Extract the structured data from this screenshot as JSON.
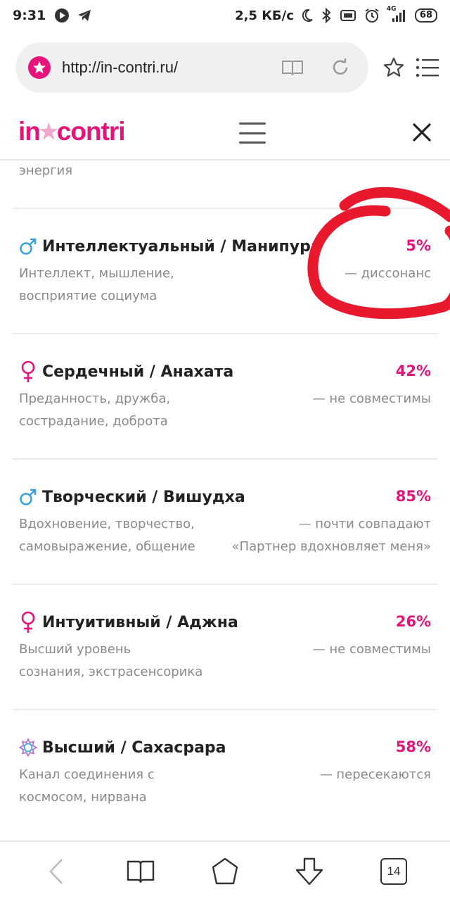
{
  "status_bar": {
    "time": "9:31",
    "net_speed": "2,5 КБ/с",
    "network": "4G",
    "battery": "68"
  },
  "browser": {
    "url": "http://in-contri.ru/",
    "tab_count": "14"
  },
  "site": {
    "logo_left": "in",
    "logo_right": "contri",
    "accent_color": "#e5137a",
    "top_fragment": "энергия"
  },
  "chakras": [
    {
      "gender_icon": "male-icon",
      "name": "Интеллектуальный",
      "sanskrit": "Манипура",
      "percent": "5%",
      "desc_line1": "Интеллект, мышление,",
      "desc_line2": "восприятие социума",
      "status_line1": "— диссонанс",
      "status_line2": ""
    },
    {
      "gender_icon": "female-icon",
      "name": "Сердечный",
      "sanskrit": "Анахата",
      "percent": "42%",
      "desc_line1": "Преданность, дружба,",
      "desc_line2": "сострадание, доброта",
      "status_line1": "— не совместимы",
      "status_line2": ""
    },
    {
      "gender_icon": "male-icon",
      "name": "Творческий",
      "sanskrit": "Вишудха",
      "percent": "85%",
      "desc_line1": "Вдохновение, творчество,",
      "desc_line2": "самовыражение, общение",
      "status_line1": "— почти совпадают",
      "status_line2": "«Партнер вдохновляет меня»"
    },
    {
      "gender_icon": "female-icon",
      "name": "Интуитивный",
      "sanskrit": "Аджна",
      "percent": "26%",
      "desc_line1": "Высший уровень",
      "desc_line2": "сознания, экстрасенсорика",
      "status_line1": "— не совместимы",
      "status_line2": ""
    },
    {
      "gender_icon": "lotus-icon",
      "name": "Высший",
      "sanskrit": "Сахасрара",
      "percent": "58%",
      "desc_line1": "Канал соединения с",
      "desc_line2": "космосом, нирвана",
      "status_line1": "— пересекаются",
      "status_line2": ""
    }
  ]
}
